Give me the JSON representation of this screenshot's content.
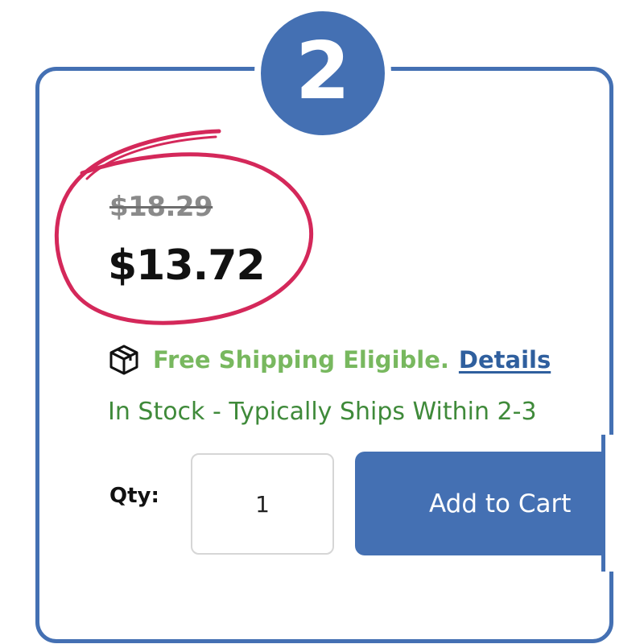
{
  "step": {
    "number": "2"
  },
  "pricing": {
    "original_price": "$18.29",
    "sale_price": "$13.72"
  },
  "shipping": {
    "icon": "package-box-icon",
    "text": "Free Shipping Eligible.",
    "details_link": "Details"
  },
  "availability": {
    "status_text": "In Stock - Typically Ships Within 2-3"
  },
  "purchase": {
    "qty_label": "Qty:",
    "qty_value": "1",
    "add_to_cart_label": "Add to Cart"
  },
  "colors": {
    "accent_blue": "#4470b3",
    "highlight_circle": "#d4285a",
    "shipping_green": "#78b85f",
    "stock_green": "#3f8a3a",
    "link_blue": "#2f5f9e",
    "strikethrough_gray": "#8a8a8a"
  }
}
